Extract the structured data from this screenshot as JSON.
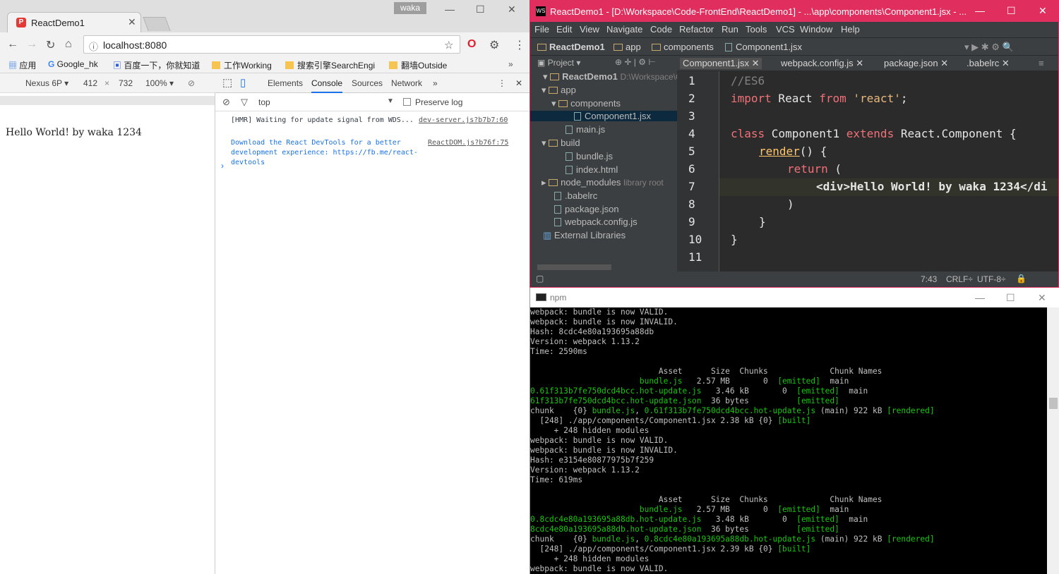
{
  "chrome": {
    "tab_title": "ReactDemo1",
    "profile_badge": "waka",
    "url": "localhost:8080",
    "bookmarks": [
      "应用",
      "Google_hk",
      "百度一下，你就知道",
      "工作Working",
      "搜索引擎SearchEngi",
      "翻墙Outside"
    ],
    "device": {
      "name": "Nexus 6P",
      "width": "412",
      "height": "732",
      "zoom": "100%"
    },
    "page_text": "Hello World! by waka 1234",
    "devtools_tabs": [
      "Elements",
      "Console",
      "Sources",
      "Network"
    ],
    "console_context": "top",
    "preserve_log": "Preserve log",
    "console": [
      {
        "text": "[HMR] Waiting for update signal from WDS...",
        "src": "dev-server.js?b7b7:60"
      },
      {
        "text": "Download the React DevTools for a better development experience: https://fb.me/react-devtools",
        "src": "ReactDOM.js?b76f:75"
      }
    ]
  },
  "ide": {
    "title": "ReactDemo1 - [D:\\Workspace\\Code-FrontEnd\\ReactDemo1] - ...\\app\\components\\Component1.jsx - ...",
    "menu": [
      "File",
      "Edit",
      "View",
      "Navigate",
      "Code",
      "Refactor",
      "Run",
      "Tools",
      "VCS",
      "Window",
      "Help"
    ],
    "breadcrumb": [
      "ReactDemo1",
      "app",
      "components",
      "Component1.jsx"
    ],
    "project_label": "Project",
    "tree": [
      {
        "label": "ReactDemo1",
        "extra": "D:\\Workspace\\C"
      },
      {
        "label": "app"
      },
      {
        "label": "components"
      },
      {
        "label": "Component1.jsx"
      },
      {
        "label": "main.js"
      },
      {
        "label": "build"
      },
      {
        "label": "bundle.js"
      },
      {
        "label": "index.html"
      },
      {
        "label": "node_modules",
        "extra": "library root"
      },
      {
        "label": ".babelrc"
      },
      {
        "label": "package.json"
      },
      {
        "label": "webpack.config.js"
      },
      {
        "label": "External Libraries"
      }
    ],
    "editor_tabs": [
      "Component1.jsx",
      "webpack.config.js",
      "package.json",
      ".babelrc"
    ],
    "line_numbers": [
      "1",
      "2",
      "3",
      "4",
      "5",
      "6",
      "7",
      "8",
      "9",
      "10",
      "11"
    ],
    "code": {
      "l1": "//ES6",
      "l2_kw": "import",
      "l2_a": " React ",
      "l2_kw2": "from",
      "l2_str": " 'react'",
      "l2_end": ";",
      "l4_kw": "class",
      "l4_a": " Component1 ",
      "l4_kw2": "extends",
      "l4_b": " React.Component {",
      "l5_fn": "render",
      "l5_b": "() {",
      "l6_kw": "return",
      "l6_b": " (",
      "l7": "<div>Hello World! by waka 1234</di",
      "l8": ")",
      "l9": "}",
      "l10": "}"
    },
    "status": {
      "position": "7:43",
      "line_sep": "CRLF",
      "encoding": "UTF-8"
    }
  },
  "terminal": {
    "title": "npm",
    "lines": [
      [
        {
          "t": "webpack: bundle is now VALID."
        }
      ],
      [
        {
          "t": "webpack: bundle is now INVALID."
        }
      ],
      [
        {
          "t": "Hash: 8cdc4e80a193695a88db"
        }
      ],
      [
        {
          "t": "Version: webpack 1.13.2"
        }
      ],
      [
        {
          "t": "Time: 2590ms"
        }
      ],
      [
        {
          "t": ""
        }
      ],
      [
        {
          "t": "                           Asset      Size  Chunks             Chunk Names"
        }
      ],
      [
        {
          "t": "                       ",
          "c": ""
        },
        {
          "t": "bundle.js",
          "c": "g"
        },
        {
          "t": "   2.57 MB       0  "
        },
        {
          "t": "[emitted]",
          "c": "g"
        },
        {
          "t": "  main"
        }
      ],
      [
        {
          "t": "0.61f313b7fe750dcd4bcc.hot-update.js",
          "c": "g"
        },
        {
          "t": "   3.46 kB       0  "
        },
        {
          "t": "[emitted]",
          "c": "g"
        },
        {
          "t": "  main"
        }
      ],
      [
        {
          "t": "61f313b7fe750dcd4bcc.hot-update.json",
          "c": "g"
        },
        {
          "t": "  36 bytes          "
        },
        {
          "t": "[emitted]",
          "c": "g"
        }
      ],
      [
        {
          "t": "chunk    {0} "
        },
        {
          "t": "bundle.js",
          "c": "g"
        },
        {
          "t": ", "
        },
        {
          "t": "0.61f313b7fe750dcd4bcc.hot-update.js",
          "c": "g"
        },
        {
          "t": " (main) 922 kB "
        },
        {
          "t": "[rendered]",
          "c": "g"
        }
      ],
      [
        {
          "t": "  [248] ./app/components/Component1.jsx 2.38 kB {0} "
        },
        {
          "t": "[built]",
          "c": "g"
        }
      ],
      [
        {
          "t": "     + 248 hidden modules"
        }
      ],
      [
        {
          "t": "webpack: bundle is now VALID."
        }
      ],
      [
        {
          "t": "webpack: bundle is now INVALID."
        }
      ],
      [
        {
          "t": "Hash: e3154e80877975b7f259"
        }
      ],
      [
        {
          "t": "Version: webpack 1.13.2"
        }
      ],
      [
        {
          "t": "Time: 619ms"
        }
      ],
      [
        {
          "t": ""
        }
      ],
      [
        {
          "t": "                           Asset      Size  Chunks             Chunk Names"
        }
      ],
      [
        {
          "t": "                       "
        },
        {
          "t": "bundle.js",
          "c": "g"
        },
        {
          "t": "   2.57 MB       0  "
        },
        {
          "t": "[emitted]",
          "c": "g"
        },
        {
          "t": "  main"
        }
      ],
      [
        {
          "t": "0.8cdc4e80a193695a88db.hot-update.js",
          "c": "g"
        },
        {
          "t": "   3.48 kB       0  "
        },
        {
          "t": "[emitted]",
          "c": "g"
        },
        {
          "t": "  main"
        }
      ],
      [
        {
          "t": "8cdc4e80a193695a88db.hot-update.json",
          "c": "g"
        },
        {
          "t": "  36 bytes          "
        },
        {
          "t": "[emitted]",
          "c": "g"
        }
      ],
      [
        {
          "t": "chunk    {0} "
        },
        {
          "t": "bundle.js",
          "c": "g"
        },
        {
          "t": ", "
        },
        {
          "t": "0.8cdc4e80a193695a88db.hot-update.js",
          "c": "g"
        },
        {
          "t": " (main) 922 kB "
        },
        {
          "t": "[rendered]",
          "c": "g"
        }
      ],
      [
        {
          "t": "  [248] ./app/components/Component1.jsx 2.39 kB {0} "
        },
        {
          "t": "[built]",
          "c": "g"
        }
      ],
      [
        {
          "t": "     + 248 hidden modules"
        }
      ],
      [
        {
          "t": "webpack: bundle is now VALID."
        }
      ]
    ]
  },
  "icons": [
    "back-icon",
    "forward-icon",
    "reload-icon",
    "home-icon",
    "star-icon",
    "opera-icon",
    "menu-icon",
    "minimize-icon",
    "maximize-icon",
    "close-icon",
    "folder-icon",
    "file-icon"
  ]
}
